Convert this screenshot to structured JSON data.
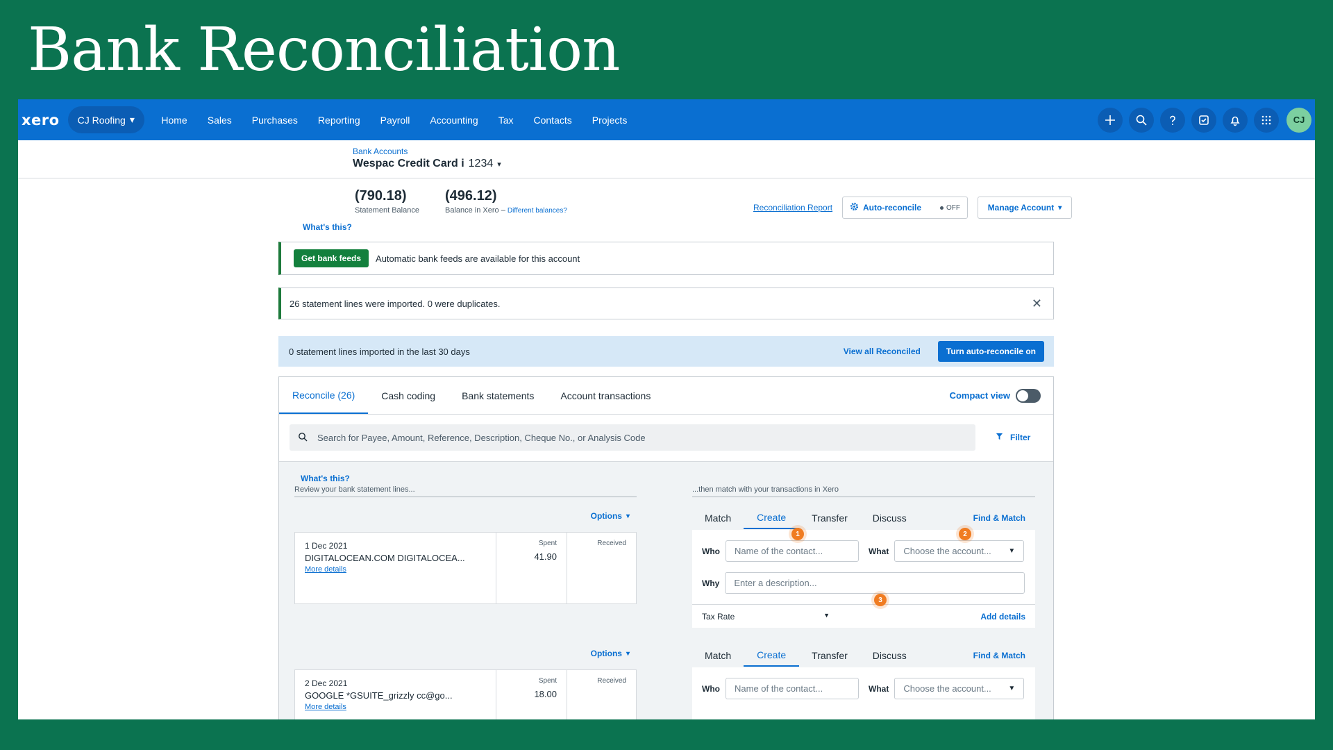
{
  "slide": {
    "title": "Bank Reconciliation"
  },
  "nav": {
    "logo": "xero",
    "org": "CJ Roofing",
    "items": [
      "Home",
      "Sales",
      "Purchases",
      "Reporting",
      "Payroll",
      "Accounting",
      "Tax",
      "Contacts",
      "Projects"
    ],
    "avatar": "CJ",
    "icons": [
      "plus-icon",
      "search-icon",
      "help-icon",
      "notes-icon",
      "bell-icon",
      "apps-grid-icon"
    ]
  },
  "account": {
    "breadcrumb": "Bank Accounts",
    "name": "Wespac Credit Card i",
    "number": "1234"
  },
  "balances": {
    "statement_value": "(790.18)",
    "statement_label": "Statement Balance",
    "xero_value": "(496.12)",
    "xero_label": "Balance in Xero –",
    "diff_link": "Different balances?",
    "whats_this": "What's this?"
  },
  "actions": {
    "reconciliation_report": "Reconciliation Report",
    "auto_reconcile": "Auto-reconcile",
    "auto_reconcile_state": "OFF",
    "manage_account": "Manage Account"
  },
  "banners": {
    "feeds_button": "Get bank feeds",
    "feeds_text": "Automatic bank feeds are available for this account",
    "import_text": "26 statement lines were imported. 0 were duplicates.",
    "close": "✕"
  },
  "info_bar": {
    "text": "0 statement lines imported in the last 30 days",
    "view_all": "View all Reconciled",
    "turn_on": "Turn auto-reconcile on"
  },
  "tabs": {
    "items": [
      "Reconcile (26)",
      "Cash coding",
      "Bank statements",
      "Account transactions"
    ],
    "active": 0,
    "compact_view": "Compact view",
    "compact_on": false
  },
  "search": {
    "placeholder": "Search for Payee, Amount, Reference, Description, Cheque No., or Analysis Code",
    "filter": "Filter"
  },
  "left_header": {
    "whats_this": "What's this?",
    "desc": "Review your bank statement lines..."
  },
  "right_header": {
    "desc": "...then match with your transactions in Xero"
  },
  "options_label": "Options",
  "statement_lines": [
    {
      "date": "1 Dec 2021",
      "payee": "DIGITALOCEAN.COM DIGITALOCEA...",
      "more": "More details",
      "spent_label": "Spent",
      "spent": "41.90",
      "received_label": "Received"
    },
    {
      "date": "2 Dec 2021",
      "payee": "GOOGLE *GSUITE_grizzly cc@go...",
      "more": "More details",
      "spent_label": "Spent",
      "spent": "18.00",
      "received_label": "Received"
    }
  ],
  "match_panel": {
    "tabs": [
      "Match",
      "Create",
      "Transfer",
      "Discuss"
    ],
    "active": 1,
    "find_match": "Find & Match",
    "who_label": "Who",
    "who_placeholder": "Name of the contact...",
    "what_label": "What",
    "what_placeholder": "Choose the account...",
    "why_label": "Why",
    "why_placeholder": "Enter a description...",
    "tax_rate": "Tax Rate",
    "add_details": "Add details",
    "steps": [
      "1",
      "2",
      "3"
    ]
  },
  "colors": {
    "slide_bg": "#0b7350",
    "xero_blue": "#0a6fd1",
    "green_accent": "#13803d",
    "step_orange": "#f07c21"
  }
}
